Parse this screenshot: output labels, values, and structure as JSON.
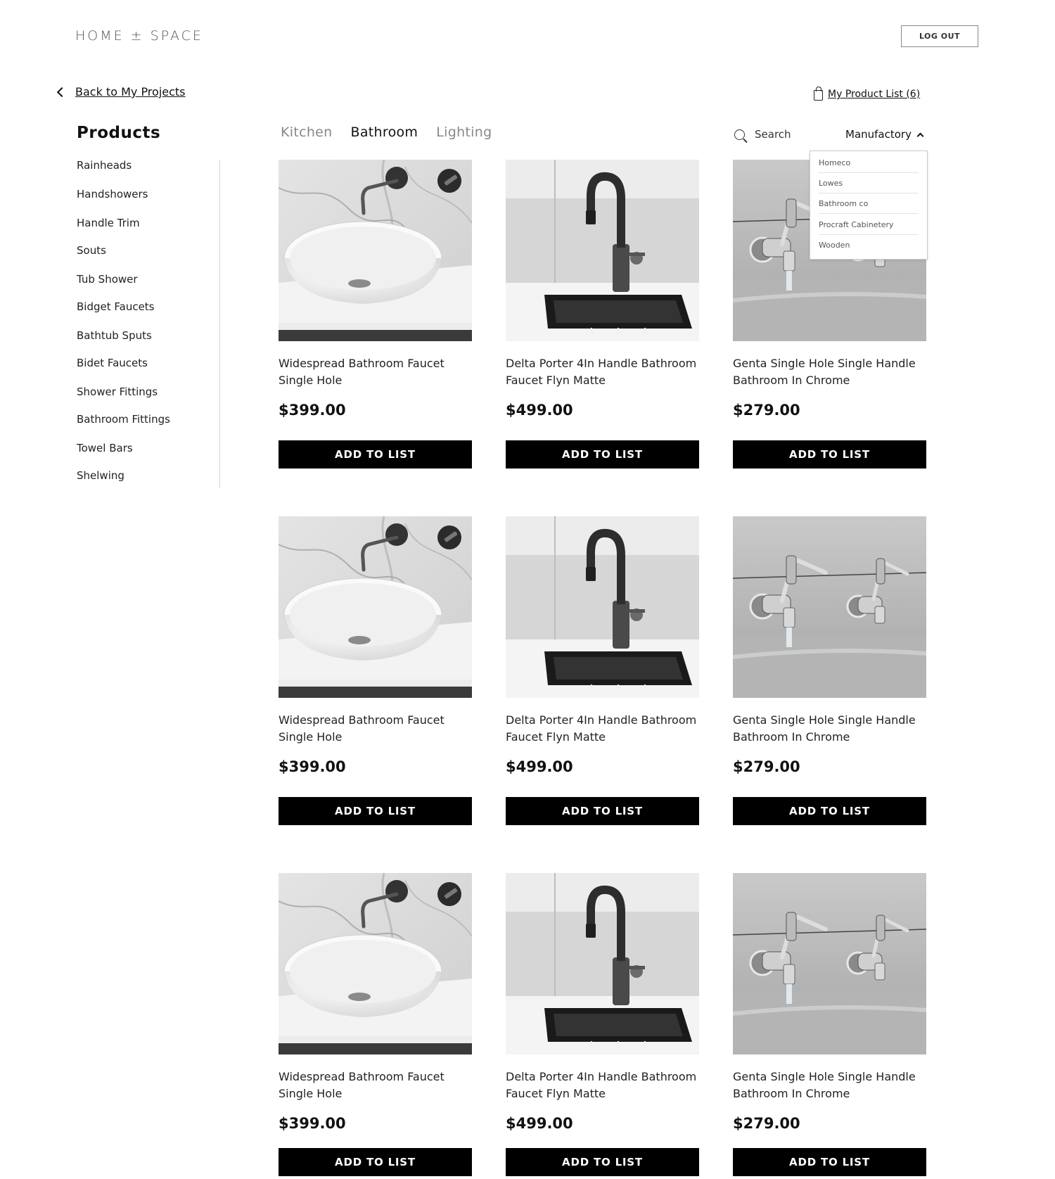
{
  "header": {
    "logo": "HOME ± SPACE",
    "logout_label": "LOG OUT"
  },
  "nav": {
    "back_label": "Back to My Projects",
    "product_list_label": "My Product List (6)"
  },
  "sidebar": {
    "title": "Products",
    "items": [
      "Rainheads",
      "Handshowers",
      "Handle Trim",
      "Souts",
      "Tub Shower",
      "Bidget Faucets",
      "Bathtub Sputs",
      "Bidet Faucets",
      "Shower Fittings",
      "Bathroom Fittings",
      "Towel Bars",
      "Shelwing"
    ]
  },
  "tabs": [
    {
      "label": "Kitchen",
      "active": false
    },
    {
      "label": "Bathroom",
      "active": true
    },
    {
      "label": "Lighting",
      "active": false
    }
  ],
  "search": {
    "placeholder": "Search"
  },
  "filter": {
    "label": "Manufactory",
    "options": [
      "Homeco",
      "Lowes",
      "Bathroom co",
      "Procraft Cabinetery",
      "Wooden"
    ]
  },
  "products": [
    {
      "name": "Widespread Bathroom Faucet Single Hole",
      "price": "$399.00",
      "button": "ADD TO LIST",
      "image": "vessel-sink-photo"
    },
    {
      "name": "Delta Porter 4In Handle Bathroom Faucet Flyn Matte",
      "price": "$499.00",
      "button": "ADD TO LIST",
      "image": "kitchen-faucet-photo"
    },
    {
      "name": "Genta Single Hole Single Handle Bathroom In Chrome",
      "price": "$279.00",
      "button": "ADD TO LIST",
      "image": "wall-taps-photo"
    },
    {
      "name": "Widespread Bathroom Faucet Single Hole",
      "price": "$399.00",
      "button": "ADD TO LIST",
      "image": "vessel-sink-photo"
    },
    {
      "name": "Delta Porter 4In Handle Bathroom Faucet Flyn Matte",
      "price": "$499.00",
      "button": "ADD TO LIST",
      "image": "kitchen-faucet-photo"
    },
    {
      "name": "Genta Single Hole Single Handle Bathroom In Chrome",
      "price": "$279.00",
      "button": "ADD TO LIST",
      "image": "wall-taps-photo"
    },
    {
      "name": "Widespread Bathroom Faucet Single Hole",
      "price": "$399.00",
      "button": "ADD TO LIST",
      "image": "vessel-sink-photo"
    },
    {
      "name": "Delta Porter 4In Handle Bathroom Faucet Flyn Matte",
      "price": "$499.00",
      "button": "ADD TO LIST",
      "image": "kitchen-faucet-photo"
    },
    {
      "name": "Genta Single Hole Single Handle Bathroom In Chrome",
      "price": "$279.00",
      "button": "ADD TO LIST",
      "image": "wall-taps-photo"
    }
  ]
}
